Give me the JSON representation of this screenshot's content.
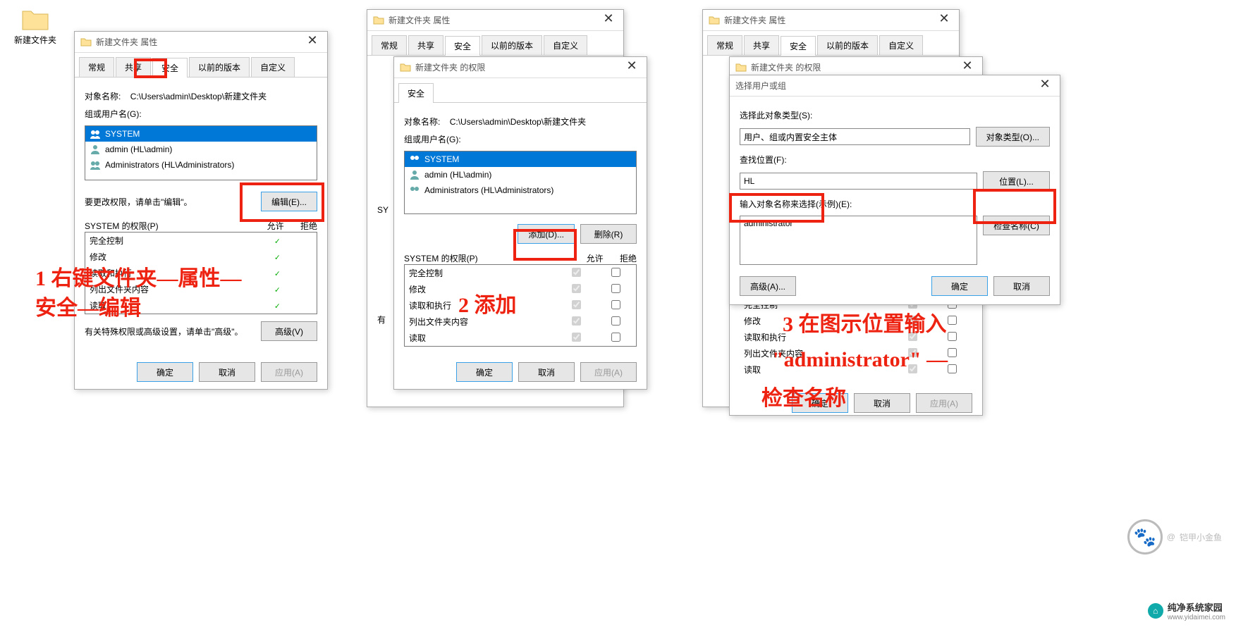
{
  "desktop": {
    "folder_name": "新建文件夹"
  },
  "win1": {
    "title": "新建文件夹 属性",
    "tabs": {
      "general": "常规",
      "share": "共享",
      "security": "安全",
      "prev": "以前的版本",
      "custom": "自定义"
    },
    "object_lbl": "对象名称:",
    "object_path": "C:\\Users\\admin\\Desktop\\新建文件夹",
    "group_lbl": "组或用户名(G):",
    "users": {
      "u1": "SYSTEM",
      "u2": "admin (HL\\admin)",
      "u3": "Administrators (HL\\Administrators)"
    },
    "edit_hint": "要更改权限，请单击\"编辑\"。",
    "edit_btn": "编辑(E)...",
    "perm_title": "SYSTEM 的权限(P)",
    "col_allow": "允许",
    "col_deny": "拒绝",
    "perms": {
      "full": "完全控制",
      "mod": "修改",
      "rdexec": "读取和执行",
      "list": "列出文件夹内容",
      "read": "读取"
    },
    "adv_hint": "有关特殊权限或高级设置，请单击\"高级\"。",
    "adv_btn": "高级(V)",
    "ok": "确定",
    "cancel": "取消",
    "apply": "应用(A)"
  },
  "win2": {
    "bg_title": "新建文件夹 属性",
    "title": "新建文件夹 的权限",
    "sec_tab": "安全",
    "object_lbl": "对象名称:",
    "object_path": "C:\\Users\\admin\\Desktop\\新建文件夹",
    "group_lbl": "组或用户名(G):",
    "users": {
      "u1": "SYSTEM",
      "u2": "admin (HL\\admin)",
      "u3": "Administrators (HL\\Administrators)"
    },
    "add_btn": "添加(D)...",
    "remove_btn": "删除(R)",
    "perm_title": "SYSTEM 的权限(P)",
    "col_allow": "允许",
    "col_deny": "拒绝",
    "perms": {
      "full": "完全控制",
      "mod": "修改",
      "rdexec": "读取和执行",
      "list": "列出文件夹内容",
      "read": "读取"
    },
    "ok": "确定",
    "cancel": "取消",
    "apply": "应用(A)",
    "side_lbl1": "SY",
    "side_lbl2": "有"
  },
  "win3": {
    "bg_title": "新建文件夹 属性",
    "mid_title": "新建文件夹 的权限",
    "title": "选择用户或组",
    "type_lbl": "选择此对象类型(S):",
    "type_val": "用户、组或内置安全主体",
    "type_btn": "对象类型(O)...",
    "loc_lbl": "查找位置(F):",
    "loc_val": "HL",
    "loc_btn": "位置(L)...",
    "name_lbl": "输入对象名称来选择(示例)(E):",
    "name_val": "administrator",
    "check_btn": "检查名称(C)",
    "adv_btn": "高级(A)...",
    "ok": "确定",
    "cancel": "取消",
    "perms": {
      "full": "完全控制",
      "mod": "修改",
      "rdexec": "读取和执行",
      "list": "列出文件夹内容",
      "read": "读取"
    }
  },
  "anno": {
    "step1": "1 右键文件夹—属性—\n安全—编辑",
    "step2": "2 添加",
    "step3a": "3 在图示位置输入",
    "step3b": "\"administrator\" —",
    "step3c": "检查名称"
  },
  "wm": {
    "at": "@",
    "name": "铠甲小金鱼"
  },
  "badge": {
    "name": "纯净系统家园",
    "url": "www.yidaimei.com"
  }
}
